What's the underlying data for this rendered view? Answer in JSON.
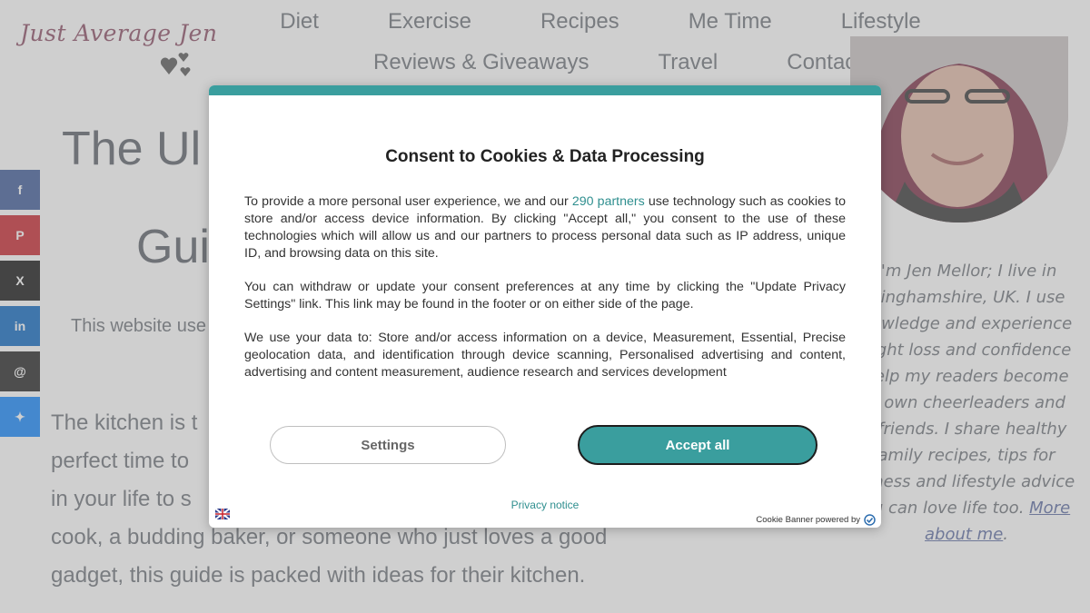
{
  "site": {
    "logo_text": "Just Average Jen",
    "nav": {
      "row1": [
        "Diet",
        "Exercise",
        "Recipes",
        "Me Time",
        "Lifestyle"
      ],
      "row2": [
        "Reviews & Giveaways",
        "Travel",
        "Contact"
      ]
    },
    "icons": {
      "search": "search-icon",
      "logo_hearts": "hearts-icon"
    },
    "page_title_visible_1": "The Ul",
    "page_title_visible_2": "Gui",
    "disclosure_visible": "This website use",
    "article_lines": [
      "The kitchen is t",
      "perfect time to",
      "in your life to s",
      "cook, a budding baker, or someone who just loves a good",
      "gadget, this guide is packed with ideas for their kitchen."
    ],
    "share_buttons": [
      {
        "icon": "facebook-icon",
        "glyph": "f",
        "color": "#3b5998"
      },
      {
        "icon": "pinterest-icon",
        "glyph": "P",
        "color": "#c8232c"
      },
      {
        "icon": "x-icon",
        "glyph": "X",
        "color": "#111111"
      },
      {
        "icon": "linkedin-icon",
        "glyph": "in",
        "color": "#0a66c2"
      },
      {
        "icon": "threads-icon",
        "glyph": "@",
        "color": "#222222"
      },
      {
        "icon": "bluesky-icon",
        "glyph": "✦",
        "color": "#1185fe"
      }
    ],
    "bio_lines": [
      "I'm Jen Mellor; I live in",
      "ttinghamshire, UK. I use",
      "nowledge and experience",
      "eight loss and confidence",
      "help my readers become",
      "ir own cheerleaders and",
      "t friends. I share healthy",
      "amily recipes, tips for",
      "piness and lifestyle advice",
      "ou can love life too."
    ],
    "bio_link_1": "More",
    "bio_link_2": "about me",
    "bio_link_suffix": "."
  },
  "modal": {
    "title": "Consent to Cookies & Data Processing",
    "para1_pre": "To provide a more personal user experience, we and our",
    "para1_link": "290 partners",
    "para1_post": "use technology such as cookies to store and/or access device information. By clicking \"Accept all,\" you consent to the use of these technologies which will allow us and our partners to process personal data such as IP address, unique ID, and browsing data on this site.",
    "para2": "You can withdraw or update your consent preferences at any time by clicking the \"Update Privacy Settings\" link. This link may be found in the footer or on either side of the page.",
    "para3": "We use your data to: Store and/or access information on a device, Measurement, Essential, Precise geolocation data, and identification through device scanning, Personalised advertising and content, advertising and content measurement, audience research and services development",
    "settings_label": "Settings",
    "accept_label": "Accept all",
    "privacy_label": "Privacy notice",
    "powered_label": "Cookie Banner powered by",
    "accent_color": "#3a9e9e"
  }
}
